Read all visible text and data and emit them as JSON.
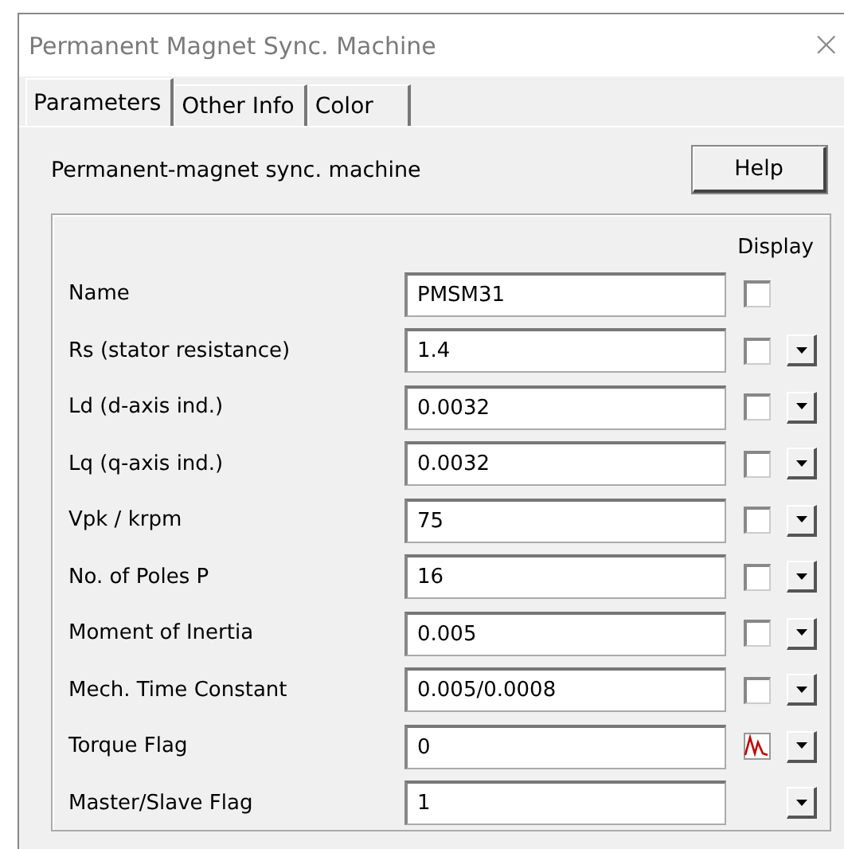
{
  "window": {
    "title": "Permanent Magnet Sync. Machine",
    "close": "×"
  },
  "tabs": [
    {
      "label": "Parameters",
      "selected": true
    },
    {
      "label": "Other Info",
      "selected": false
    },
    {
      "label": "Color",
      "selected": false
    }
  ],
  "description": "Permanent-magnet sync. machine",
  "help_button": "Help",
  "display_heading": "Display",
  "parameters": [
    {
      "label": "Name",
      "value": "PMSM31",
      "kind": "checkbox",
      "checked": false,
      "dropdown": false
    },
    {
      "label": "Rs (stator resistance)",
      "value": "1.4",
      "kind": "checkbox",
      "checked": false,
      "dropdown": true
    },
    {
      "label": "Ld (d-axis ind.)",
      "value": "0.0032",
      "kind": "checkbox",
      "checked": false,
      "dropdown": true
    },
    {
      "label": "Lq (q-axis ind.)",
      "value": "0.0032",
      "kind": "checkbox",
      "checked": false,
      "dropdown": true
    },
    {
      "label": "Vpk / krpm",
      "value": "75",
      "kind": "checkbox",
      "checked": false,
      "dropdown": true
    },
    {
      "label": "No. of Poles P",
      "value": "16",
      "kind": "checkbox",
      "checked": false,
      "dropdown": true
    },
    {
      "label": "Moment of Inertia",
      "value": "0.005",
      "kind": "checkbox",
      "checked": false,
      "dropdown": true
    },
    {
      "label": "Mech. Time Constant",
      "value": "0.005/0.0008",
      "kind": "checkbox",
      "checked": false,
      "dropdown": true
    },
    {
      "label": "Torque Flag",
      "value": "0",
      "kind": "waveform",
      "dropdown": true
    },
    {
      "label": "Master/Slave Flag",
      "value": "1",
      "kind": "plain",
      "dropdown": true
    }
  ]
}
